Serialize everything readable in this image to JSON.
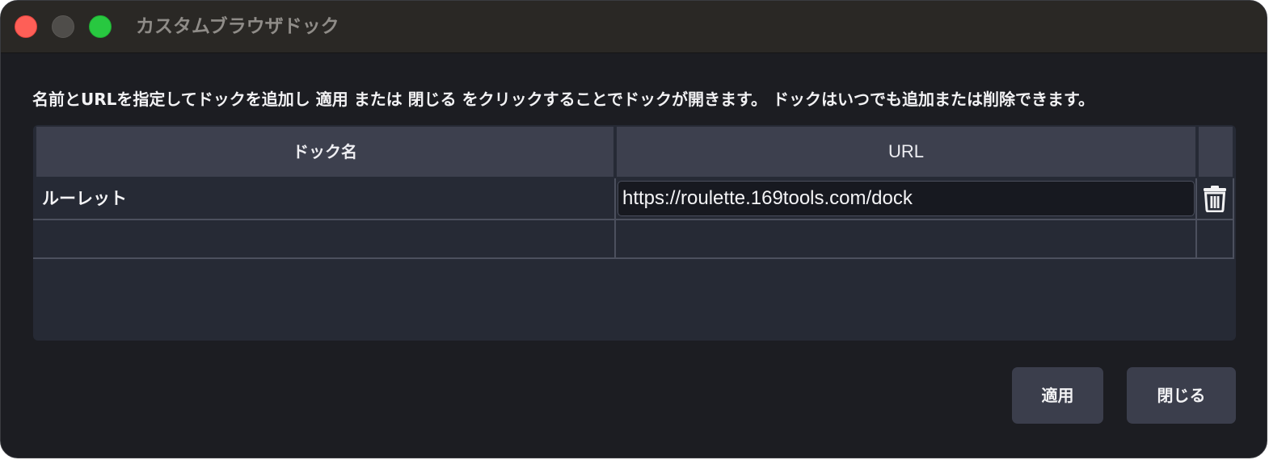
{
  "window": {
    "title": "カスタムブラウザドック",
    "controls": [
      "close-icon",
      "minimize-icon",
      "maximize-icon"
    ]
  },
  "description": "名前とURLを指定してドックを追加し 適用 または 閉じる をクリックすることでドックが開きます。 ドックはいつでも追加または削除できます。",
  "table": {
    "headers": {
      "name": "ドック名",
      "url": "URL"
    },
    "rows": [
      {
        "name": "ルーレット",
        "url": "https://roulette.169tools.com/dock",
        "action_icon": "trash-icon"
      },
      {
        "name": "",
        "url": ""
      }
    ]
  },
  "buttons": {
    "apply": "適用",
    "close": "閉じる"
  },
  "colors": {
    "background": "#1c1d22",
    "titlebar": "#2a2825",
    "table_panel": "#262a35",
    "header": "#3d404e",
    "button": "#3b3e4c",
    "traffic_close": "#fe5f57",
    "traffic_min": "#4f4d4a",
    "traffic_max": "#28c840"
  }
}
